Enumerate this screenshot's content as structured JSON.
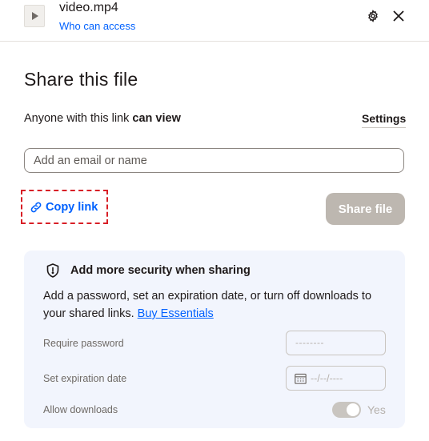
{
  "header": {
    "file_name": "video.mp4",
    "access_link": "Who can access",
    "icons": {
      "file": "play-icon",
      "settings": "gear-icon",
      "close": "close-icon"
    }
  },
  "share": {
    "title": "Share this file",
    "access_prefix": "Anyone with this link ",
    "access_level": "can view",
    "settings_label": "Settings",
    "input_placeholder": "Add an email or name",
    "input_value": "",
    "copy_link_label": "Copy link",
    "share_button_label": "Share file"
  },
  "security": {
    "title": "Add more security when sharing",
    "description": "Add a password, set an expiration date, or turn off downloads to your shared links. ",
    "upgrade_link": "Buy Essentials",
    "password_label": "Require password",
    "password_placeholder": "--------",
    "expiration_label": "Set expiration date",
    "expiration_placeholder": "--/--/----",
    "downloads_label": "Allow downloads",
    "downloads_value": "Yes",
    "downloads_enabled": true
  },
  "colors": {
    "accent": "#0061fe",
    "highlight_border": "#d81f26",
    "disabled_button": "#bdb7b0",
    "card_background": "#f2f5fd"
  }
}
